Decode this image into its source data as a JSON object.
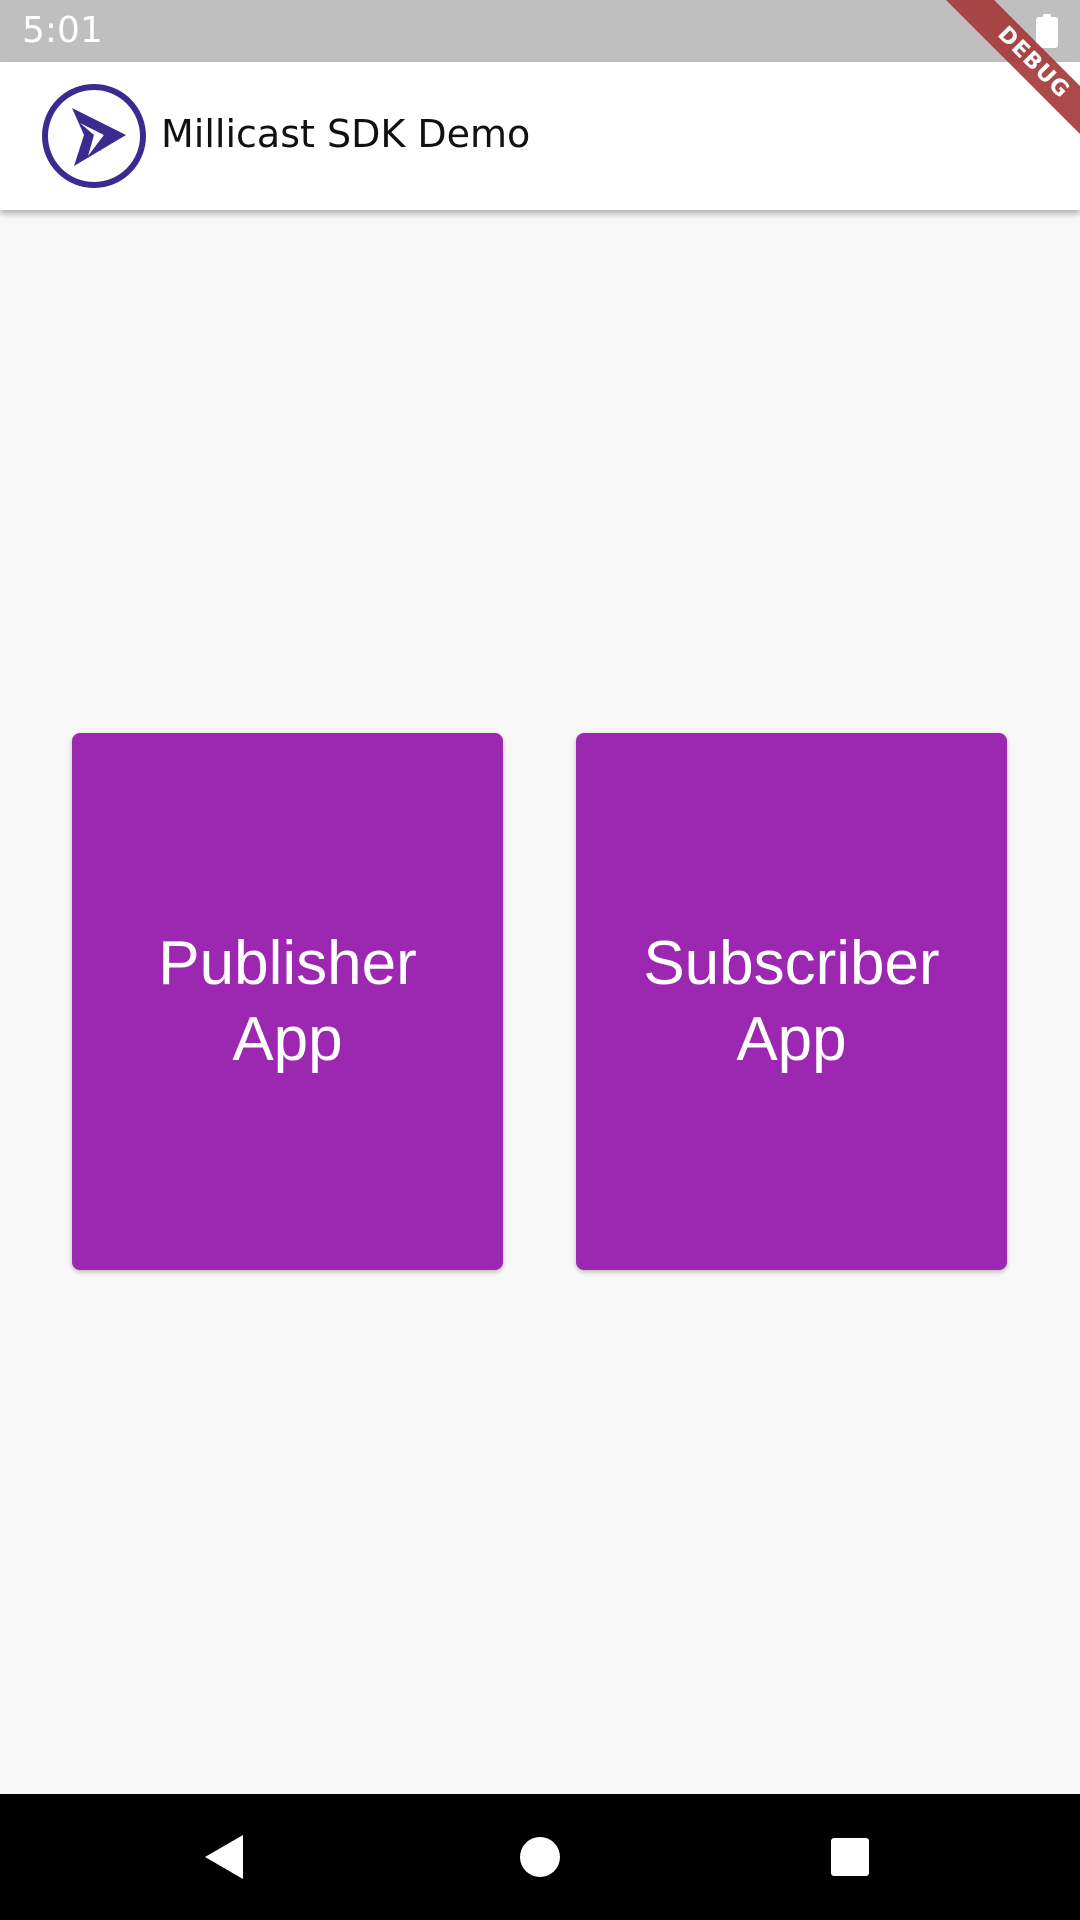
{
  "status_bar": {
    "time": "5:01",
    "battery_icon": "battery-full-icon"
  },
  "app_bar": {
    "title": "Millicast SDK Demo",
    "logo_icon": "millicast-logo-icon",
    "logo_color": "#3b2a8f"
  },
  "debug_banner": {
    "label": "DEBUG",
    "color": "#a53a3a"
  },
  "cards": {
    "publisher": {
      "line1": "Publisher",
      "line2": "App"
    },
    "subscriber": {
      "line1": "Subscriber",
      "line2": "App"
    },
    "color": "#9c27b0"
  },
  "nav_bar": {
    "back_icon": "back-triangle-icon",
    "home_icon": "home-circle-icon",
    "recents_icon": "recents-square-icon"
  }
}
